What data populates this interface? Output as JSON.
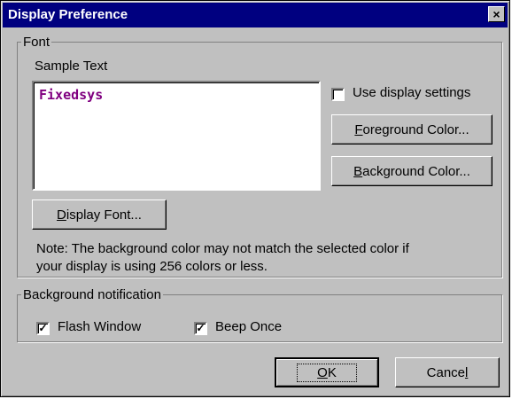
{
  "window": {
    "title": "Display Preference",
    "close_label": "×"
  },
  "font_group": {
    "legend": "Font",
    "sample_label": "Sample Text",
    "sample_value": "Fixedsys",
    "sample_color": "#800080",
    "use_display_settings": {
      "label": "Use display settings",
      "checked": false
    },
    "foreground_button": {
      "accel": "F",
      "rest": "oreground Color..."
    },
    "background_button": {
      "accel": "B",
      "rest": "ackground Color..."
    },
    "display_font_button": {
      "accel": "D",
      "rest": "isplay Font..."
    },
    "note_line1": "Note:  The background color may not match the selected color if",
    "note_line2": "your display is using 256 colors or less."
  },
  "notification_group": {
    "legend": "Background notification",
    "flash_window": {
      "label": "Flash Window",
      "checked": true,
      "mark": "✓"
    },
    "beep_once": {
      "label": "Beep Once",
      "checked": true,
      "mark": "✓"
    }
  },
  "footer": {
    "ok_button": {
      "accel": "O",
      "rest": "K"
    },
    "cancel_button": {
      "pre": "Cance",
      "accel": "l"
    }
  },
  "colors": {
    "title_bar": "#000080",
    "face": "#c0c0c0"
  }
}
